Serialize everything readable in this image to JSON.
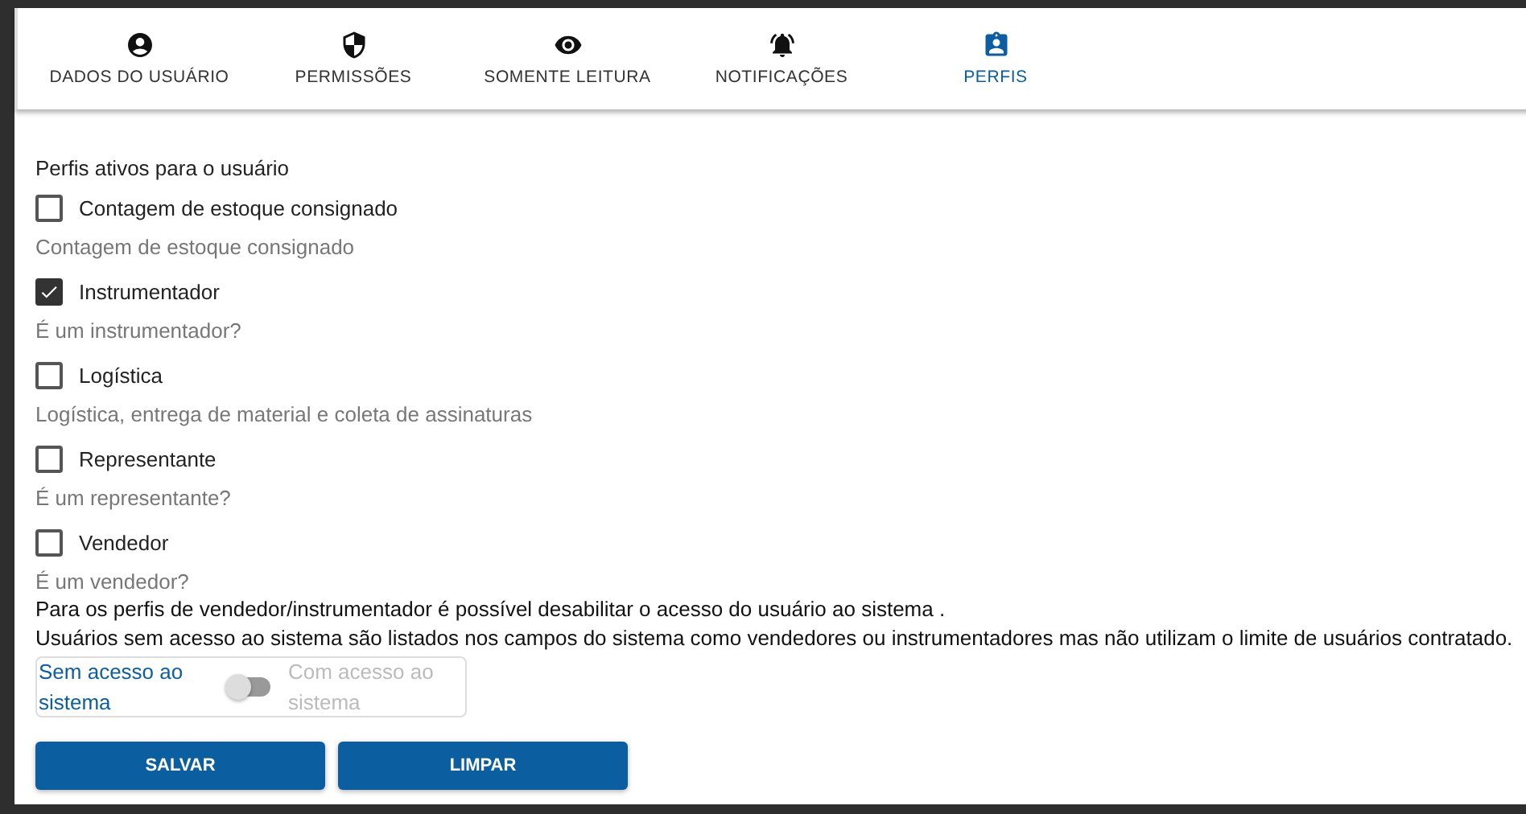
{
  "tabs": [
    {
      "label": "DADOS DO USUÁRIO",
      "selected": false
    },
    {
      "label": "PERMISSÕES",
      "selected": false
    },
    {
      "label": "SOMENTE LEITURA",
      "selected": false
    },
    {
      "label": "NOTIFICAÇÕES",
      "selected": false
    },
    {
      "label": "PERFIS",
      "selected": true
    }
  ],
  "section_title": "Perfis ativos para o usuário",
  "profiles": [
    {
      "label": "Contagem de estoque consignado",
      "checked": false,
      "description": "Contagem de estoque consignado"
    },
    {
      "label": "Instrumentador",
      "checked": true,
      "description": "É um instrumentador?"
    },
    {
      "label": "Logística",
      "checked": false,
      "description": "Logística, entrega de material e coleta de assinaturas"
    },
    {
      "label": "Representante",
      "checked": false,
      "description": "É um representante?"
    },
    {
      "label": "Vendedor",
      "checked": false,
      "description": "É um vendedor?"
    }
  ],
  "notes": [
    "Para os perfis de vendedor/instrumentador é possível desabilitar o acesso do usuário ao sistema .",
    "Usuários sem acesso ao sistema são listados nos campos do sistema como vendedores ou instrumentadores mas não utilizam o limite de usuários contratado."
  ],
  "access_toggle": {
    "off_label": "Sem acesso ao sistema",
    "on_label": "Com acesso ao sistema",
    "on": false
  },
  "buttons": [
    "SALVAR",
    "LIMPAR"
  ]
}
